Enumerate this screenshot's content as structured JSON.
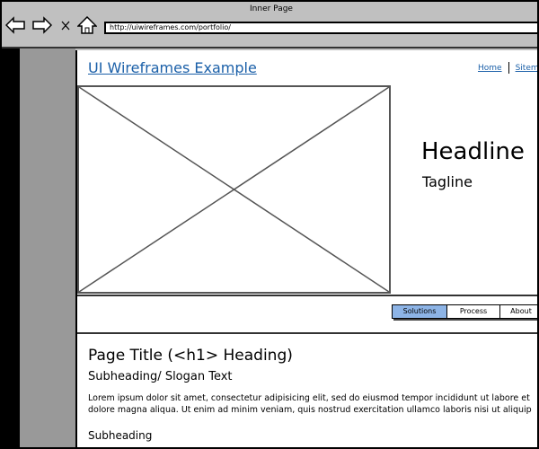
{
  "browser": {
    "title": "Inner Page",
    "url": "http://uiwireframes.com/portfolio/",
    "icons": [
      "back-arrow-icon",
      "forward-arrow-icon",
      "stop-x-icon",
      "home-icon"
    ]
  },
  "header": {
    "logo": "UI Wireframes Example",
    "links": [
      "Home",
      "Sitemap"
    ],
    "link_color": "#1a5fa8"
  },
  "hero": {
    "headline": "Headline",
    "tagline": "Tagline"
  },
  "nav": {
    "tabs": [
      {
        "label": "Solutions",
        "active": true
      },
      {
        "label": "Process",
        "active": false
      },
      {
        "label": "About",
        "active": false
      }
    ],
    "active_color": "#8db4e6"
  },
  "content": {
    "title": "Page Title (<h1> Heading)",
    "slogan": "Subheading/ Slogan Text",
    "body": "Lorem ipsum dolor sit amet, consectetur adipisicing elit, sed do eiusmod tempor incididunt ut labore et dolore magna aliqua. Ut enim ad minim veniam, quis nostrud exercitation ullamco laboris nisi ut aliquip ex ea commodo consequat.",
    "subheading": "Subheading"
  }
}
